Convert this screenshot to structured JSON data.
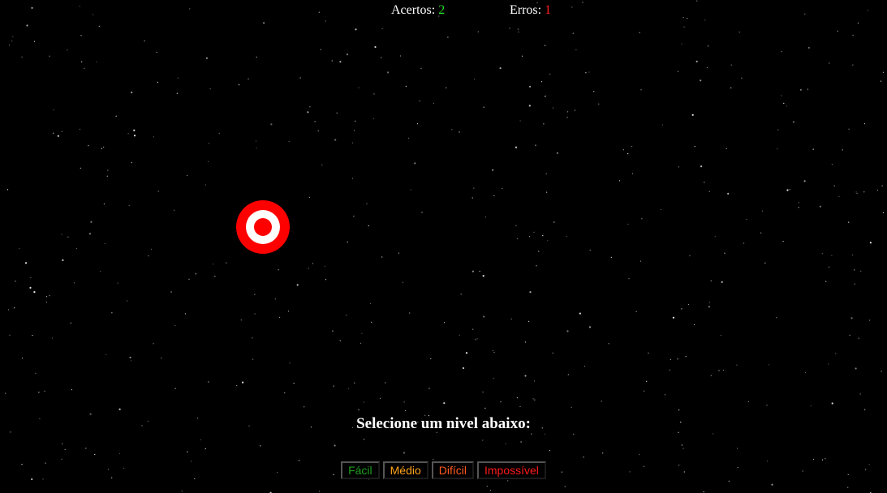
{
  "scoreboard": {
    "hits_label": "Acertos:",
    "hits_value": "2",
    "errors_label": "Erros:",
    "errors_value": "1"
  },
  "level_selector": {
    "prompt": "Selecione um nivel abaixo:",
    "buttons": [
      {
        "label": "Fácil",
        "color": "#1f9e1f"
      },
      {
        "label": "Médio",
        "color": "#ffa31a"
      },
      {
        "label": "Difícil",
        "color": "#ff5a1f"
      },
      {
        "label": "Impossível",
        "color": "#ff1a1a"
      }
    ]
  },
  "colors": {
    "background": "#000000",
    "hits_value": "#22dd22",
    "errors_value": "#ff2222",
    "target_red": "#ff0000",
    "target_white": "#ffffff"
  }
}
